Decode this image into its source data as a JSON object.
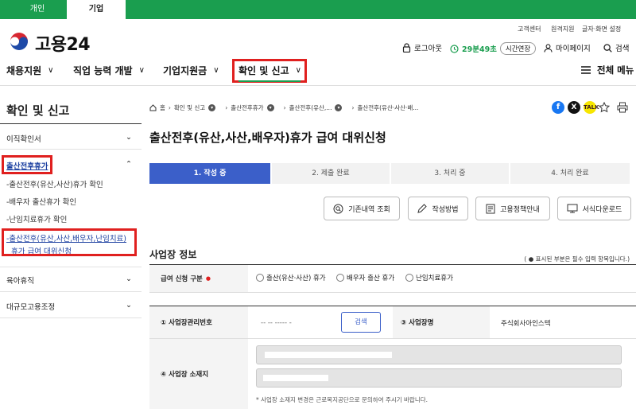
{
  "top_tabs": [
    "개인",
    "기업"
  ],
  "util_links": [
    "고객센터",
    "원격지원",
    "글자·화면 설정"
  ],
  "brand": {
    "name": "고용24"
  },
  "header": {
    "logout": "로그아웃",
    "timer": "29분49초",
    "extend": "시간연장",
    "mypage": "마이페이지",
    "search": "검색"
  },
  "gnb": [
    "채용지원",
    "직업 능력 개발",
    "기업지원금",
    "확인 및 신고"
  ],
  "full_menu": "전체 메뉴",
  "sidebar": {
    "title": "확인 및 신고",
    "items": [
      "이직확인서",
      "출산전후휴가",
      "육아휴직",
      "대규모고용조정"
    ],
    "subitems": [
      "-출산전후(유산,사산)휴가 확인",
      "-배우자 출산휴가 확인",
      "-난임치료휴가 확인",
      "-출산전후(유산,사산,배우자,난임치료)",
      "휴가 급여 대위신청"
    ]
  },
  "breadcrumb": [
    "홈",
    "확인 및 신고",
    "출산전후휴가",
    "출산전후(유산,...",
    "출산전후(유산·사산·배..."
  ],
  "page_title": "출산전후(유산,사산,배우자)휴가 급여 대위신청",
  "steps": [
    "1. 작성 중",
    "2. 제출 완료",
    "3. 처리 중",
    "4. 처리 완료"
  ],
  "buttons": [
    "기존내역 조회",
    "작성방법",
    "고용정책안내",
    "서식다운로드"
  ],
  "section": {
    "title": "사업장 정보",
    "note": "( ● 표시된 부분은 필수 입력 항목입니다.)"
  },
  "form": {
    "type_label": "급여 신청 구분",
    "type_options": [
      "출산(유산·사산) 휴가",
      "배우자 출산 휴가",
      "난임치료휴가"
    ],
    "reg_no_label": "① 사업장관리번호",
    "reg_no_value": "-- -- ----- -",
    "search_button": "검색",
    "biz_name_label": "③ 사업장명",
    "biz_name_value": "주식회사아인스텍",
    "address_label": "④ 사업장 소재지",
    "address_note": "* 사업장 소재지 변경은 근로복지공단으로 문의하여 주시기 바랍니다."
  },
  "colors": {
    "brand_green": "#1a9e4f",
    "highlight_red": "#e0201f",
    "step_active": "#3b5fc9",
    "link_blue": "#1b3fa0"
  }
}
